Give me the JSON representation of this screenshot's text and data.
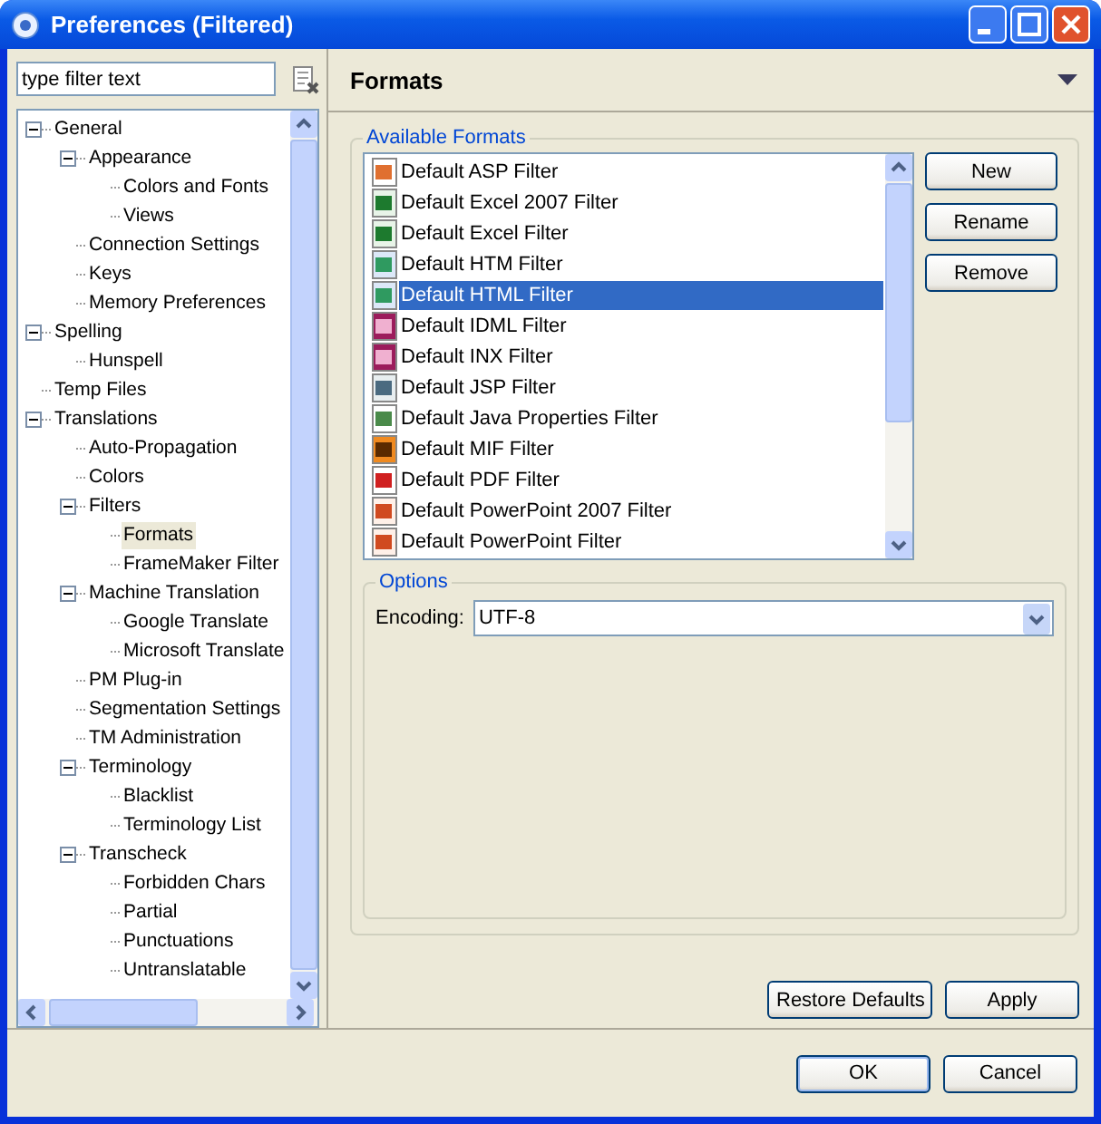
{
  "window": {
    "title": "Preferences (Filtered)"
  },
  "filter": {
    "value": "type filter text"
  },
  "tree": [
    {
      "label": "General",
      "expanded": true,
      "selected": false,
      "children": [
        {
          "label": "Appearance",
          "expanded": true,
          "selected": false,
          "children": [
            {
              "label": "Colors and Fonts",
              "selected": false
            },
            {
              "label": "Views",
              "selected": false
            }
          ]
        },
        {
          "label": "Connection Settings",
          "selected": false
        },
        {
          "label": "Keys",
          "selected": false
        },
        {
          "label": "Memory Preferences",
          "selected": false
        }
      ]
    },
    {
      "label": "Spelling",
      "expanded": true,
      "selected": false,
      "children": [
        {
          "label": "Hunspell",
          "selected": false
        }
      ]
    },
    {
      "label": "Temp Files",
      "selected": false
    },
    {
      "label": "Translations",
      "expanded": true,
      "selected": false,
      "children": [
        {
          "label": "Auto-Propagation",
          "selected": false
        },
        {
          "label": "Colors",
          "selected": false
        },
        {
          "label": "Filters",
          "expanded": true,
          "selected": false,
          "children": [
            {
              "label": "Formats",
              "selected": true
            },
            {
              "label": "FrameMaker Filter",
              "selected": false
            }
          ]
        },
        {
          "label": "Machine Translation",
          "expanded": true,
          "selected": false,
          "children": [
            {
              "label": "Google Translate",
              "selected": false
            },
            {
              "label": "Microsoft Translate",
              "selected": false
            }
          ]
        },
        {
          "label": "PM Plug-in",
          "selected": false
        },
        {
          "label": "Segmentation Settings",
          "selected": false
        },
        {
          "label": "TM Administration",
          "selected": false
        },
        {
          "label": "Terminology",
          "expanded": true,
          "selected": false,
          "children": [
            {
              "label": "Blacklist",
              "selected": false
            },
            {
              "label": "Terminology List",
              "selected": false
            }
          ]
        },
        {
          "label": "Transcheck",
          "expanded": true,
          "selected": false,
          "children": [
            {
              "label": "Forbidden Chars",
              "selected": false
            },
            {
              "label": "Partial",
              "selected": false
            },
            {
              "label": "Punctuations",
              "selected": false
            },
            {
              "label": "Untranslatable",
              "selected": false
            }
          ]
        }
      ]
    }
  ],
  "page": {
    "title": "Formats",
    "group": "Available Formats",
    "formats": [
      {
        "label": "Default ASP Filter",
        "kind": "asp",
        "selected": false
      },
      {
        "label": "Default Excel 2007 Filter",
        "kind": "excel",
        "selected": false
      },
      {
        "label": "Default Excel Filter",
        "kind": "excel",
        "selected": false
      },
      {
        "label": "Default HTM Filter",
        "kind": "web",
        "selected": false
      },
      {
        "label": "Default HTML Filter",
        "kind": "web",
        "selected": true
      },
      {
        "label": "Default IDML Filter",
        "kind": "indesign",
        "selected": false
      },
      {
        "label": "Default INX Filter",
        "kind": "indesign",
        "selected": false
      },
      {
        "label": "Default JSP Filter",
        "kind": "jsp",
        "selected": false
      },
      {
        "label": "Default Java Properties Filter",
        "kind": "java",
        "selected": false
      },
      {
        "label": "Default MIF Filter",
        "kind": "framemaker",
        "selected": false
      },
      {
        "label": "Default PDF Filter",
        "kind": "pdf",
        "selected": false
      },
      {
        "label": "Default PowerPoint 2007 Filter",
        "kind": "powerpoint",
        "selected": false
      },
      {
        "label": "Default PowerPoint Filter",
        "kind": "powerpoint",
        "selected": false
      }
    ],
    "side_buttons": [
      "New",
      "Rename",
      "Remove"
    ],
    "options": {
      "title": "Options",
      "encoding_label": "Encoding:",
      "encoding_value": "UTF-8"
    },
    "page_buttons": [
      "Restore Defaults",
      "Apply"
    ]
  },
  "buttons": [
    "OK",
    "Cancel"
  ]
}
